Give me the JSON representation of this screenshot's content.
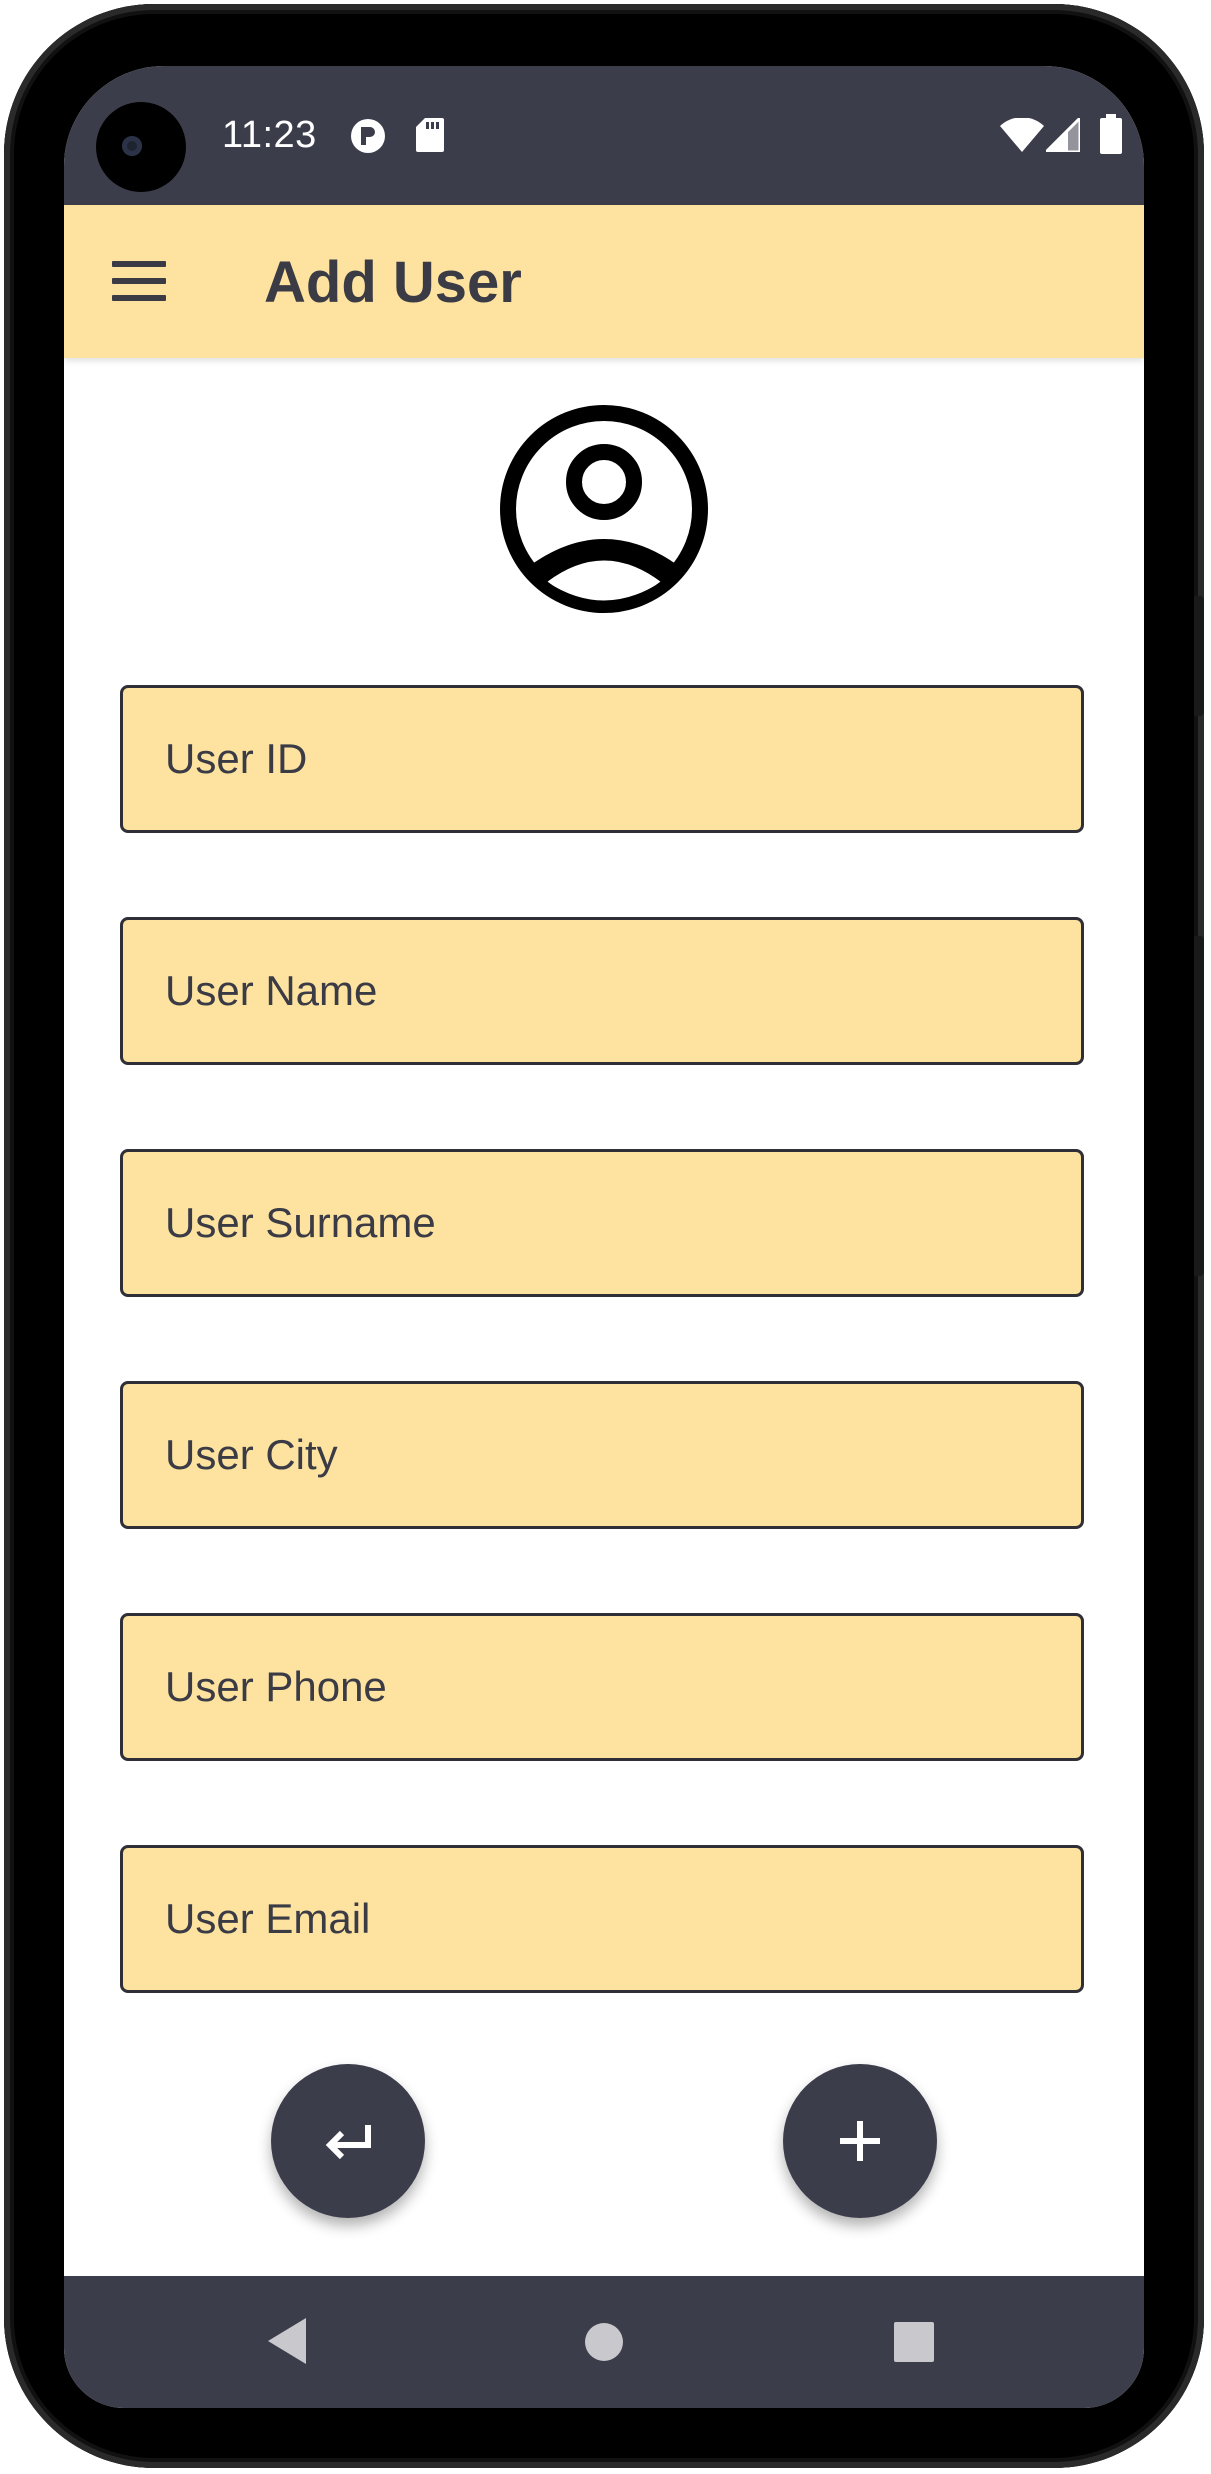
{
  "status_bar": {
    "time": "11:23"
  },
  "app_bar": {
    "title": "Add User",
    "menu_icon": "hamburger-menu-icon"
  },
  "avatar_icon": "account-circle-icon",
  "form": {
    "fields": [
      {
        "name": "user-id-input",
        "placeholder": "User ID"
      },
      {
        "name": "user-name-input",
        "placeholder": "User Name"
      },
      {
        "name": "user-surname-input",
        "placeholder": "User Surname"
      },
      {
        "name": "user-city-input",
        "placeholder": "User City"
      },
      {
        "name": "user-phone-input",
        "placeholder": "User Phone"
      },
      {
        "name": "user-email-input",
        "placeholder": "User Email"
      }
    ]
  },
  "actions": {
    "back_icon": "keyboard-return-icon",
    "add_icon": "plus-icon"
  },
  "navigation": {
    "back": "nav-back-icon",
    "home": "nav-home-icon",
    "recents": "nav-recents-icon"
  },
  "colors": {
    "accent_yellow": "#fde39f",
    "dark_bar": "#3c3d4b",
    "text_dark": "#3b3b46"
  }
}
